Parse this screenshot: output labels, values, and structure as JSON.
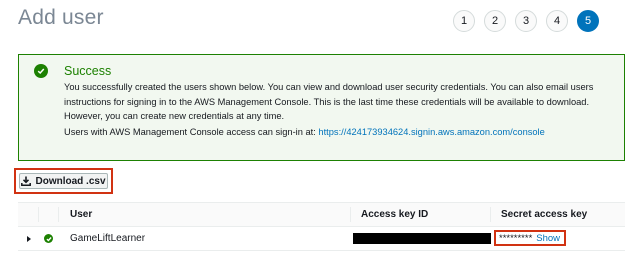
{
  "header": {
    "title": "Add user"
  },
  "steps": [
    {
      "label": "1",
      "active": false
    },
    {
      "label": "2",
      "active": false
    },
    {
      "label": "3",
      "active": false
    },
    {
      "label": "4",
      "active": false
    },
    {
      "label": "5",
      "active": true
    }
  ],
  "alert": {
    "title": "Success",
    "body": "You successfully created the users shown below. You can view and download user security credentials. You can also email users instructions for signing in to the AWS Management Console. This is the last time these credentials will be available to download. However, you can create new credentials at any time.",
    "console_prefix": "Users with AWS Management Console access can sign-in at:",
    "console_url": "https://424173934624.signin.aws.amazon.com/console"
  },
  "toolbar": {
    "download_label": "Download .csv",
    "download_icon": "download-icon"
  },
  "table": {
    "columns": [
      "User",
      "Access key ID",
      "Secret access key"
    ],
    "rows": [
      {
        "user": "GameLiftLearner",
        "access_key_id": "",
        "secret_mask": "*********",
        "show_label": "Show"
      }
    ]
  },
  "colors": {
    "accent": "#0073bb",
    "success": "#1d8102",
    "highlight": "#d13212"
  }
}
